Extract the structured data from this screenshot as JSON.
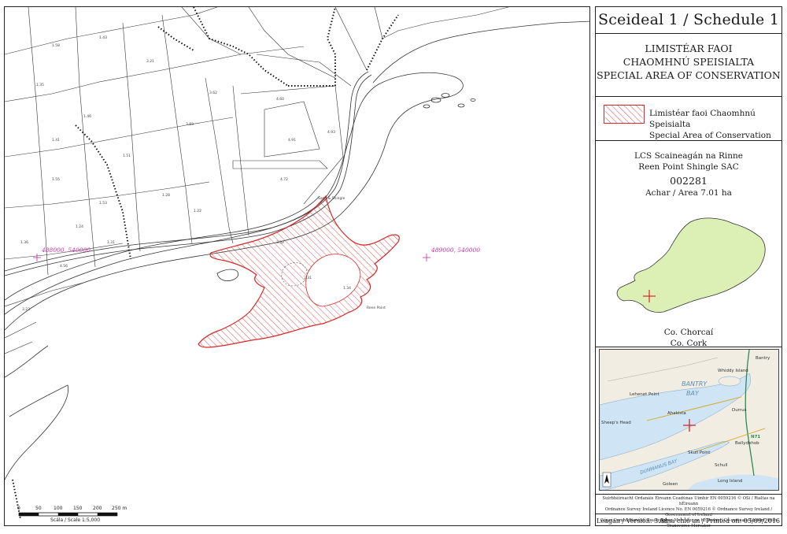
{
  "schedule": {
    "title": "Sceideal 1 / Schedule 1"
  },
  "designation": {
    "line1": "LIMISTÉAR FAOI",
    "line2": "CHAOMHNÚ SPEISIALTA",
    "line3": "SPECIAL AREA OF CONSERVATION"
  },
  "legend": {
    "label_irish": "Limistéar faoi Chaomhnú Speisialta",
    "label_english": "Special Area of Conservation",
    "color": "#d62828"
  },
  "site": {
    "name_irish": "LCS Scaineagán na Rinne",
    "name_english": "Reen Point Shingle SAC",
    "code": "002281",
    "area": "Achar / Area 7.01 ha"
  },
  "county": {
    "irish": "Co. Chorcaí",
    "english": "Co. Cork",
    "fill": "#dcefb4"
  },
  "map": {
    "coord_left": "488000, 540000",
    "coord_right": "489000, 540000",
    "scale_ticks": [
      "0",
      "50",
      "100",
      "150",
      "200",
      "250 m"
    ],
    "scale_label": "Scála / Scale 1:5,000",
    "parcel_labels": [
      "1.58",
      "1.43",
      "1.35",
      "3.21",
      "3.62",
      "4.60",
      "4.91",
      "4.93",
      "1.46",
      "1.41",
      "1.51",
      "3.83",
      "4.72",
      "1.55",
      "1.53",
      "1.28",
      "1.22",
      "1.24",
      "1.31",
      "1.36",
      "4.56",
      "3.31",
      "3.52",
      "1.34",
      "3.22",
      "Sand &\nShingle",
      "Reen Point"
    ]
  },
  "inset": {
    "labels": [
      "Whiddy Island",
      "Bantry",
      "Lehenet Point",
      "Ahakista",
      "BANTRY",
      "BAY",
      "DUNMANUS BAY",
      "Long Island",
      "Schull",
      "Durrus",
      "Ballydehob",
      "Skull Point",
      "Goleen",
      "Sheep's Head",
      "N71"
    ],
    "water_color": "#cfe4f5"
  },
  "copyright": {
    "line1": "Suirbhéireacht Ordanáis Éireann Ceadúnas Uimhir EN 0059216 © OSi / Rialtas na hÉireann",
    "line2": "Ordnance Survey Ireland Licence No. EN 0059216 © Ordnance Survey Ireland / Government of Ireland",
    "line3": "Córas Comhordanáidí Trasteilgean Mercator na hÉireann / Co-ordinate System: Irish Transverse Mercator"
  },
  "footer": {
    "version": "Leagan / Version: 3.01",
    "printed": "Arna chló an / Printed on: 05/09/2016"
  }
}
